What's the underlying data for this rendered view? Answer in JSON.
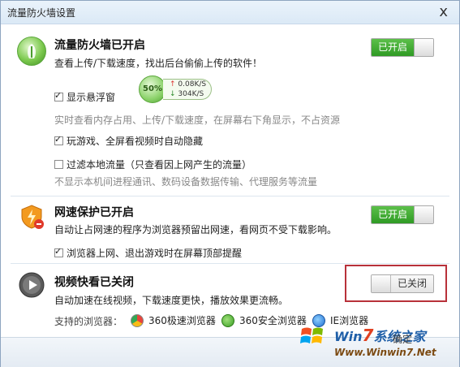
{
  "window": {
    "title": "流量防火墙设置",
    "close_label": "x"
  },
  "firewall": {
    "heading": "流量防火墙已开启",
    "subtitle": "查看上传/下载速度，找出后台偷偷上传的软件！",
    "toggle_label": "已开启",
    "show_floatball": {
      "label": "显示悬浮窗",
      "checked": true
    },
    "floatball": {
      "percent": "50%",
      "up": "0.08K/S",
      "down": "304K/S"
    },
    "floatball_desc": "实时查看内存占用、上传/下载速度，在屏幕右下角显示，不占资源",
    "game_hide": {
      "label": "玩游戏、全屏看视频时自动隐藏",
      "checked": true
    },
    "filter_local": {
      "label": "过滤本地流量（只查看因上网产生的流量）",
      "checked": false
    },
    "filter_desc": "不显示本机间进程通讯、数码设备数据传输、代理服务等流量"
  },
  "speed_protect": {
    "heading": "网速保护已开启",
    "subtitle": "自动让占网速的程序为浏览器预留出网速，看网页不受下载影响。",
    "toggle_label": "已开启",
    "remind": {
      "label": "浏览器上网、退出游戏时在屏幕顶部提醒",
      "checked": true
    }
  },
  "video": {
    "heading": "视频快看已关闭",
    "subtitle": "自动加速在线视频，下载速度更快，播放效果更流畅。",
    "toggle_label": "已关闭",
    "supported_label": "支持的浏览器：",
    "browsers": [
      "360极速浏览器",
      "360安全浏览器",
      "IE浏览器"
    ]
  },
  "watermark": {
    "title_a": "Win",
    "title_seven": "7",
    "title_b": "系统之家",
    "url": "Www.Winwin7.Net",
    "ok_label": "确定"
  },
  "colors": {
    "toggle_on": "#3aa52c",
    "highlight_border": "#b8313a",
    "title_bg": "#dbe9f6"
  }
}
